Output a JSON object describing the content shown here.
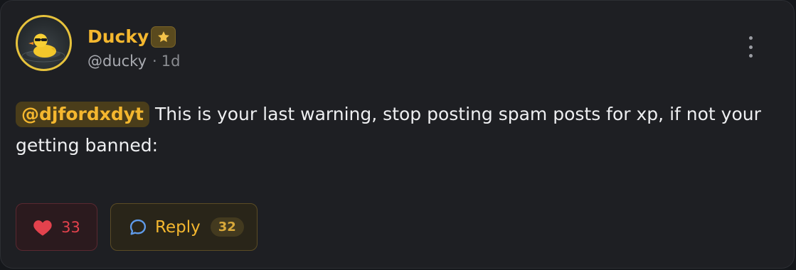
{
  "post": {
    "author": {
      "name": "Ducky",
      "handle": "@ducky",
      "separator": "·",
      "time": "1d",
      "badge_icon": "star-icon",
      "name_color": "#f4b72f"
    },
    "mention": "@djfordxdyt",
    "text": "This is your last warning, stop posting spam posts for xp, if not your getting banned:",
    "actions": {
      "like_count": "33",
      "reply_label": "Reply",
      "reply_count": "32"
    }
  }
}
